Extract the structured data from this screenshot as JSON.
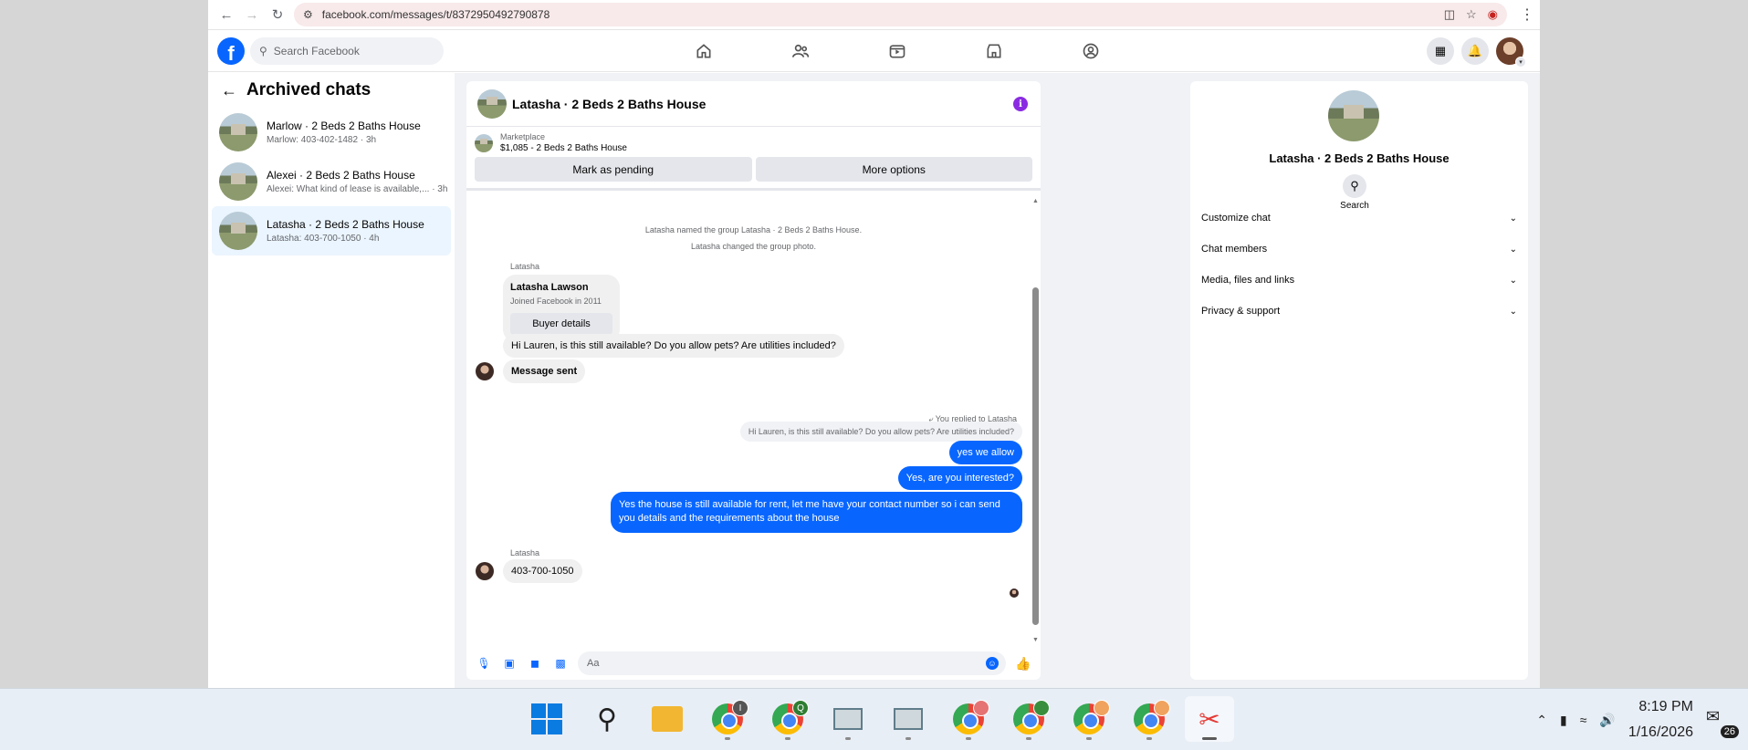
{
  "browser": {
    "url": "facebook.com/messages/t/8372950492790878",
    "search_placeholder": "Search Facebook"
  },
  "left": {
    "title": "Archived chats",
    "chats": [
      {
        "name": "Marlow · 2 Beds 2 Baths House",
        "sub": "Marlow: 403-402-1482 · 3h"
      },
      {
        "name": "Alexei · 2 Beds 2 Baths House",
        "sub": "Alexei: What kind of lease is available,... · 3h"
      },
      {
        "name": "Latasha · 2 Beds 2 Baths House",
        "sub": "Latasha: 403-700-1050 · 4h"
      }
    ]
  },
  "chat": {
    "title": "Latasha · 2 Beds 2 Baths House",
    "marketplace_label": "Marketplace",
    "listing": "$1,085 - 2 Beds 2 Baths House",
    "mark_pending": "Mark as pending",
    "more_options": "More options",
    "sys1": "Latasha named the group Latasha · 2 Beds 2 Baths House.",
    "sys2": "Latasha changed the group photo.",
    "sender": "Latasha",
    "buyer_name": "Latasha Lawson",
    "buyer_joined": "Joined Facebook in 2011",
    "buyer_details": "Buyer details",
    "msg_in1": "Hi Lauren, is this still available? Do you allow pets? Are utilities included?",
    "msg_sent": "Message sent",
    "reply_tag": "You replied to Latasha",
    "quoted": "Hi Lauren, is this still available? Do you allow pets? Are utilities included?",
    "out1": "yes we allow",
    "out2": "Yes, are you interested?",
    "out3": "Yes the house is still available for rent, let me have your contact number so i can send you details and the requirements about the house",
    "sender2": "Latasha",
    "msg_in2": "403-700-1050",
    "composer_placeholder": "Aa"
  },
  "right": {
    "name": "Latasha · 2 Beds 2 Baths House",
    "search_label": "Search",
    "sections": [
      "Customize chat",
      "Chat members",
      "Media, files and links",
      "Privacy & support"
    ]
  },
  "taskbar": {
    "time": "8:19 PM",
    "date": "1/16/2026",
    "notif_count": "26",
    "badge_1": "I",
    "badge_2": "Q"
  }
}
